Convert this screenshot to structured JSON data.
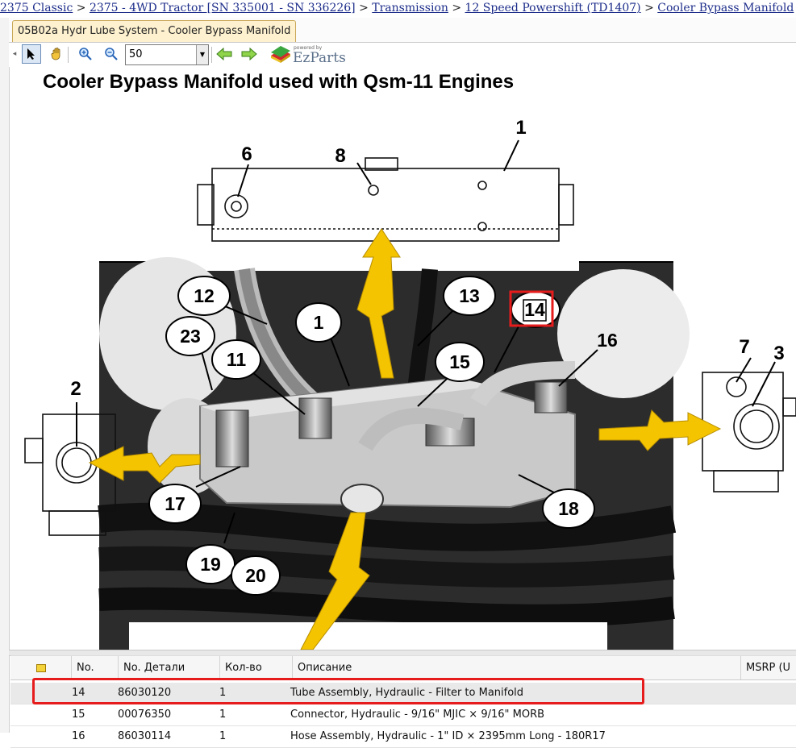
{
  "breadcrumb": {
    "items": [
      "2375 Classic",
      "2375 - 4WD Tractor [SN 335001 - SN 336226]",
      "Transmission",
      "12 Speed Powershift (TD1407)",
      "Cooler Bypass Manifold"
    ],
    "separator": ">"
  },
  "tab": {
    "label": "05B02a Hydr Lube System - Cooler Bypass Manifold"
  },
  "toolbar": {
    "zoom_value": "50",
    "icons": [
      "arrow-pointer-icon",
      "pan-hand-icon",
      "zoom-in-icon",
      "zoom-out-icon",
      "back-arrow-icon",
      "forward-arrow-icon"
    ],
    "powered_by": "powered by",
    "brand": "EzParts"
  },
  "drawing": {
    "title": "Cooler Bypass Manifold used with Qsm-11 Engines",
    "callouts": [
      "1",
      "2",
      "3",
      "6",
      "7",
      "8",
      "12",
      "13",
      "14",
      "1",
      "23",
      "11",
      "15",
      "16",
      "17",
      "18",
      "19",
      "20"
    ],
    "highlight_color": "#e61c1c",
    "arrow_color": "#f5c400"
  },
  "table": {
    "columns": [
      "",
      "No.",
      "No. Детали",
      "Кол-во",
      "Описание",
      "MSRP (U"
    ],
    "rows": [
      {
        "no": "14",
        "part": "86030120",
        "qty": "1",
        "desc": "Tube Assembly, Hydraulic - Filter to Manifold",
        "selected": true
      },
      {
        "no": "15",
        "part": "00076350",
        "qty": "1",
        "desc": "Connector, Hydraulic - 9/16\" MJIC × 9/16\" MORB",
        "selected": false
      },
      {
        "no": "16",
        "part": "86030114",
        "qty": "1",
        "desc": "Hose Assembly, Hydraulic - 1\" ID × 2395mm Long - 180R17",
        "selected": false
      }
    ]
  }
}
